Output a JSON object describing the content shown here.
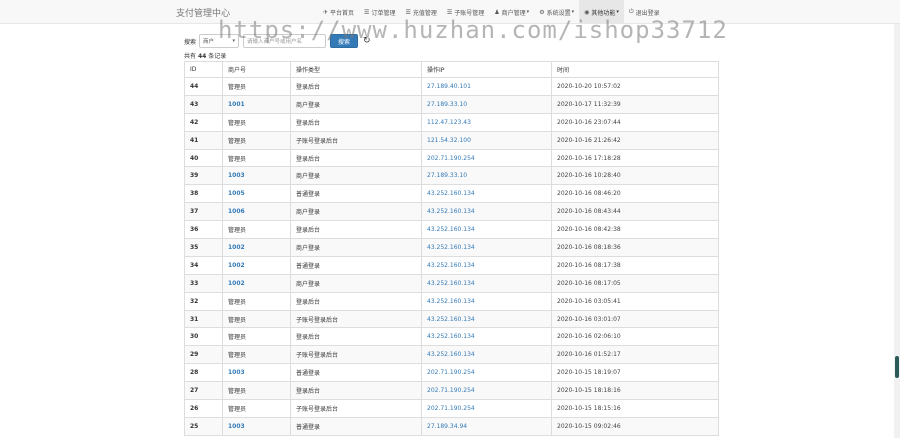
{
  "app": {
    "title": "支付管理中心"
  },
  "nav": {
    "items": [
      {
        "icon": "home-icon",
        "glyph": "✈",
        "label": "平台首页",
        "caret": false,
        "active": false
      },
      {
        "icon": "list-icon",
        "glyph": "☰",
        "label": "订单管理",
        "caret": false,
        "active": false
      },
      {
        "icon": "list-icon",
        "glyph": "☰",
        "label": "充值管理",
        "caret": false,
        "active": false
      },
      {
        "icon": "list-icon",
        "glyph": "☰",
        "label": "子账号管理",
        "caret": false,
        "active": false
      },
      {
        "icon": "user-icon",
        "glyph": "♟",
        "label": "商户管理",
        "caret": true,
        "active": false
      },
      {
        "icon": "gear-icon",
        "glyph": "⚙",
        "label": "系统设置",
        "caret": true,
        "active": false
      },
      {
        "icon": "globe-icon",
        "glyph": "◉",
        "label": "其他功能",
        "caret": true,
        "active": true
      },
      {
        "icon": "logout-icon",
        "glyph": "⏻",
        "label": "退出登录",
        "caret": false,
        "active": false
      }
    ]
  },
  "search": {
    "label": "搜索",
    "select_value": "商户",
    "input_placeholder": "请输入商户号或用户名",
    "button_label": "搜索"
  },
  "records": {
    "prefix": "共有",
    "count": "44",
    "suffix": "条记录"
  },
  "table": {
    "headers": [
      "ID",
      "商户号",
      "操作类型",
      "操作IP",
      "时间"
    ],
    "rows": [
      {
        "id": "44",
        "account": "管理员",
        "link": false,
        "action": "登录后台",
        "ip": "27.189.40.101",
        "time": "2020-10-20 10:57:02"
      },
      {
        "id": "43",
        "account": "1001",
        "link": true,
        "action": "商户登录",
        "ip": "27.189.33.10",
        "time": "2020-10-17 11:32:39"
      },
      {
        "id": "42",
        "account": "管理员",
        "link": false,
        "action": "登录后台",
        "ip": "112.47.123.43",
        "time": "2020-10-16 23:07:44"
      },
      {
        "id": "41",
        "account": "管理员",
        "link": false,
        "action": "子账号登录后台",
        "ip": "121.54.32.100",
        "time": "2020-10-16 21:26:42"
      },
      {
        "id": "40",
        "account": "管理员",
        "link": false,
        "action": "登录后台",
        "ip": "202.71.190.254",
        "time": "2020-10-16 17:18:28"
      },
      {
        "id": "39",
        "account": "1003",
        "link": true,
        "action": "商户登录",
        "ip": "27.189.33.10",
        "time": "2020-10-16 10:28:40"
      },
      {
        "id": "38",
        "account": "1005",
        "link": true,
        "action": "普通登录",
        "ip": "43.252.160.134",
        "time": "2020-10-16 08:46:20"
      },
      {
        "id": "37",
        "account": "1006",
        "link": true,
        "action": "商户登录",
        "ip": "43.252.160.134",
        "time": "2020-10-16 08:43:44"
      },
      {
        "id": "36",
        "account": "管理员",
        "link": false,
        "action": "登录后台",
        "ip": "43.252.160.134",
        "time": "2020-10-16 08:42:38"
      },
      {
        "id": "35",
        "account": "1002",
        "link": true,
        "action": "商户登录",
        "ip": "43.252.160.134",
        "time": "2020-10-16 08:18:36"
      },
      {
        "id": "34",
        "account": "1002",
        "link": true,
        "action": "普通登录",
        "ip": "43.252.160.134",
        "time": "2020-10-16 08:17:38"
      },
      {
        "id": "33",
        "account": "1002",
        "link": true,
        "action": "商户登录",
        "ip": "43.252.160.134",
        "time": "2020-10-16 08:17:05"
      },
      {
        "id": "32",
        "account": "管理员",
        "link": false,
        "action": "登录后台",
        "ip": "43.252.160.134",
        "time": "2020-10-16 03:05:41"
      },
      {
        "id": "31",
        "account": "管理员",
        "link": false,
        "action": "子账号登录后台",
        "ip": "43.252.160.134",
        "time": "2020-10-16 03:01:07"
      },
      {
        "id": "30",
        "account": "管理员",
        "link": false,
        "action": "登录后台",
        "ip": "43.252.160.134",
        "time": "2020-10-16 02:06:10"
      },
      {
        "id": "29",
        "account": "管理员",
        "link": false,
        "action": "子账号登录后台",
        "ip": "43.252.160.134",
        "time": "2020-10-16 01:52:17"
      },
      {
        "id": "28",
        "account": "1003",
        "link": true,
        "action": "普通登录",
        "ip": "202.71.190.254",
        "time": "2020-10-15 18:19:07"
      },
      {
        "id": "27",
        "account": "管理员",
        "link": false,
        "action": "登录后台",
        "ip": "202.71.190.254",
        "time": "2020-10-15 18:18:16"
      },
      {
        "id": "26",
        "account": "管理员",
        "link": false,
        "action": "子账号登录后台",
        "ip": "202.71.190.254",
        "time": "2020-10-15 18:15:16"
      },
      {
        "id": "25",
        "account": "1003",
        "link": true,
        "action": "普通登录",
        "ip": "27.189.34.94",
        "time": "2020-10-15 09:02:46"
      }
    ]
  },
  "watermark": "https://www.huzhan.com/ishop33712"
}
